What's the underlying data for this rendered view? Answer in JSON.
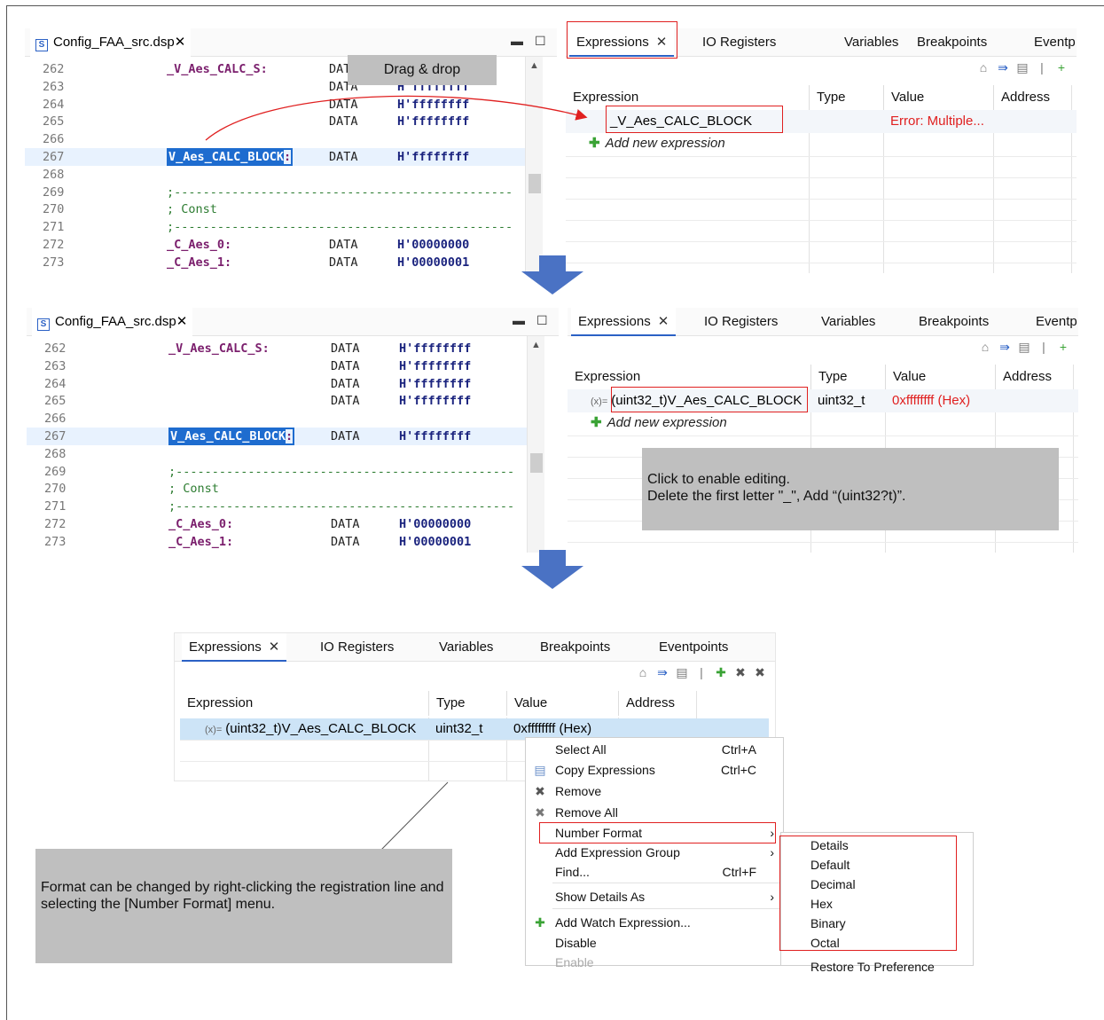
{
  "editor": {
    "tab_label": "Config_FAA_src.dsp",
    "lines": [
      {
        "num": "262",
        "label": "_V_Aes_CALC_S:",
        "directive": "DATA",
        "value": "H'ffffffff"
      },
      {
        "num": "263",
        "label": "",
        "directive": "DATA",
        "value": "H'ffffffff"
      },
      {
        "num": "264",
        "label": "",
        "directive": "DATA",
        "value": "H'ffffffff"
      },
      {
        "num": "265",
        "label": "",
        "directive": "DATA",
        "value": "H'ffffffff"
      },
      {
        "num": "266",
        "label": "",
        "directive": "",
        "value": ""
      },
      {
        "num": "267",
        "label": "V_Aes_CALC_BLOCK",
        "directive": "DATA",
        "value": "H'ffffffff"
      },
      {
        "num": "268",
        "label": "",
        "directive": "",
        "value": ""
      },
      {
        "num": "269",
        "comment": ";-----------------------------------------------"
      },
      {
        "num": "270",
        "comment": "; Const"
      },
      {
        "num": "271",
        "comment": ";-----------------------------------------------"
      },
      {
        "num": "272",
        "label": "_C_Aes_0:",
        "directive": "DATA",
        "value": "H'00000000"
      },
      {
        "num": "273",
        "label": "_C_Aes_1:",
        "directive": "DATA",
        "value": "H'00000001"
      }
    ],
    "selected_suffix": ":"
  },
  "tabs": {
    "expressions": "Expressions",
    "io_registers": "IO Registers",
    "variables": "Variables",
    "breakpoints": "Breakpoints",
    "eventpoints": "Eventpoints",
    "eventpoints_cut": "Eventp"
  },
  "columns": {
    "expression": "Expression",
    "type": "Type",
    "value": "Value",
    "address": "Address"
  },
  "step1": {
    "callout": "Drag & drop",
    "expr": "_V_Aes_CALC_BLOCK",
    "value": "Error: Multiple...",
    "add_new": "Add new expression"
  },
  "step2": {
    "expr_prefix": "(x)=",
    "expr": "(uint32_t)V_Aes_CALC_BLOCK",
    "type": "uint32_t",
    "value": "0xffffffff (Hex)",
    "add_new": "Add new expression",
    "callout_line1": "Click to enable editing.",
    "callout_line2": "Delete the first letter \"_\", Add “(uint32?t)”."
  },
  "step3": {
    "expr_prefix": "(x)=",
    "expr": "(uint32_t)V_Aes_CALC_BLOCK",
    "type": "uint32_t",
    "value": "0xffffffff (Hex)",
    "callout": "Format can be changed by right-clicking the registration line and selecting the [Number Format] menu."
  },
  "context_menu": [
    {
      "label": "Select All",
      "shortcut": "Ctrl+A",
      "icon": ""
    },
    {
      "label": "Copy Expressions",
      "shortcut": "Ctrl+C",
      "icon": "copy-icon"
    },
    {
      "label": "Remove",
      "shortcut": "",
      "icon": "remove-icon"
    },
    {
      "label": "Remove All",
      "shortcut": "",
      "icon": "remove-all-icon"
    },
    {
      "label": "Number Format",
      "shortcut": "",
      "icon": "",
      "submenu": true
    },
    {
      "label": "Add Expression Group",
      "shortcut": "",
      "icon": "",
      "submenu": true
    },
    {
      "label": "Find...",
      "shortcut": "Ctrl+F",
      "icon": ""
    },
    {
      "label": "Show Details As",
      "shortcut": "",
      "icon": "",
      "submenu": true
    },
    {
      "label": "Add Watch Expression...",
      "shortcut": "",
      "icon": "add-icon"
    },
    {
      "label": "Disable",
      "shortcut": "",
      "icon": ""
    },
    {
      "label": "Enable",
      "shortcut": "",
      "icon": "",
      "disabled": true
    }
  ],
  "submenu": [
    "Details",
    "Default",
    "Decimal",
    "Hex",
    "Binary",
    "Octal",
    "Restore To Preference"
  ]
}
